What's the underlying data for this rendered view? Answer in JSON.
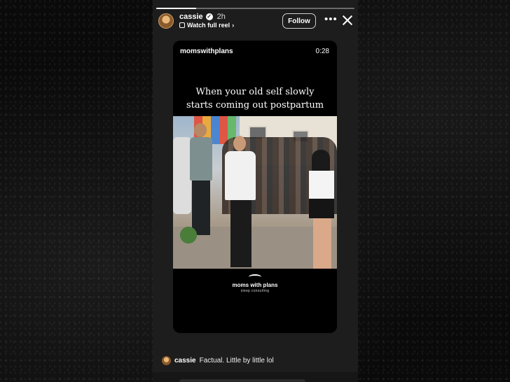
{
  "story": {
    "username": "cassie",
    "time_ago": "2h",
    "reel_link": "Watch full reel",
    "follow_label": "Follow",
    "more_label": "•••",
    "progress": 0.2
  },
  "reel": {
    "account": "momswithplans",
    "duration": "0:28",
    "caption_line1": "When your old self slowly",
    "caption_line2": "starts coming out postpartum",
    "brand_name": "moms with plans",
    "brand_sub": "sleep consulting"
  },
  "comment": {
    "username": "cassie",
    "text": "Factual. Little by little lol"
  }
}
